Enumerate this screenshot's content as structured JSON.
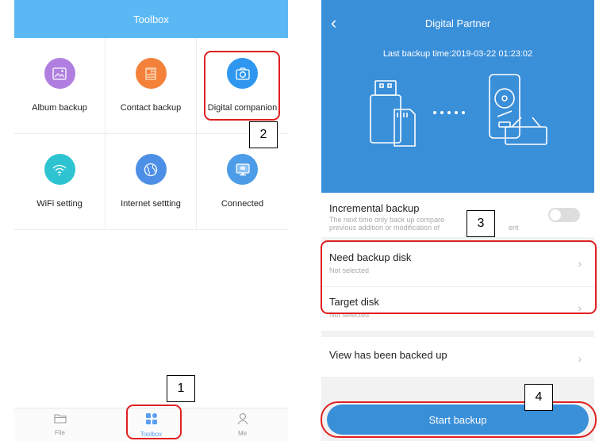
{
  "left_screen": {
    "header_title": "Toolbox",
    "tiles": [
      {
        "label": "Album backup",
        "icon": "album-icon",
        "color": "#b07ee0"
      },
      {
        "label": "Contact backup",
        "icon": "contact-icon",
        "color": "#f3813a"
      },
      {
        "label": "Digital companion",
        "icon": "camera-icon",
        "color": "#2f97f0"
      },
      {
        "label": "WiFi setting",
        "icon": "wifi-icon",
        "color": "#2ec3d0"
      },
      {
        "label": "Internet settting",
        "icon": "globe-icon",
        "color": "#4d8fe6"
      },
      {
        "label": "Connected",
        "icon": "monitor-icon",
        "color": "#4d9ce8"
      }
    ],
    "bottom_nav": [
      {
        "label": "File",
        "icon": "folder-icon"
      },
      {
        "label": "Toolbox",
        "icon": "grid-icon",
        "active": true
      },
      {
        "label": "Me",
        "icon": "person-icon"
      }
    ]
  },
  "right_screen": {
    "title": "Digital Partner",
    "last_backup": "Last backup time:2019-03-22 01:23:02",
    "incremental": {
      "title": "Incremental backup",
      "description_line1": "The next time only back up compare",
      "description_line2": "previous addition or modification of",
      "description_tail": "ent",
      "enabled": false
    },
    "need_backup_disk": {
      "title": "Need backup disk",
      "value": "Not selected"
    },
    "target_disk": {
      "title": "Target disk",
      "value": "Not selected"
    },
    "view_backed_up": "View has been backed up",
    "start_button": "Start backup"
  },
  "annotations": {
    "labels": [
      "1",
      "2",
      "3",
      "4"
    ],
    "highlight_color": "#e02020"
  },
  "colors": {
    "left_header": "#5bb8f5",
    "right_hero": "#3a8fd9",
    "active_nav": "#5b9ef2"
  }
}
